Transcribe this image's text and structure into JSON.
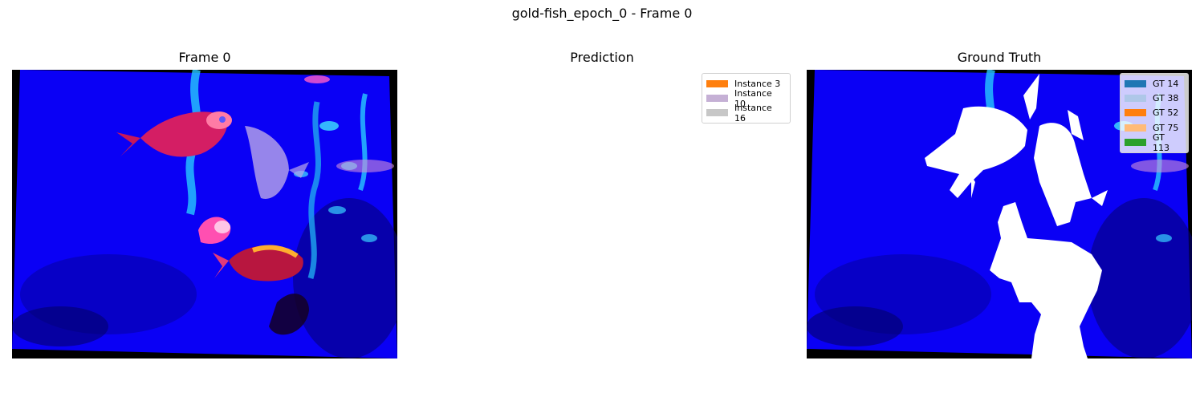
{
  "suptitle": "gold-fish_epoch_0 - Frame 0",
  "panels": {
    "frame": {
      "title": "Frame 0"
    },
    "prediction": {
      "title": "Prediction",
      "legend": [
        {
          "label": "Instance 3",
          "color": "#ff7f0e"
        },
        {
          "label": "Instance 10",
          "color": "#c5b0d5"
        },
        {
          "label": "Instance 16",
          "color": "#c7c7c7"
        }
      ]
    },
    "ground_truth": {
      "title": "Ground Truth",
      "legend": [
        {
          "label": "GT 14",
          "color": "#1f77b4"
        },
        {
          "label": "GT 38",
          "color": "#aec7e8"
        },
        {
          "label": "GT 52",
          "color": "#ff7f0e"
        },
        {
          "label": "GT 75",
          "color": "#ffbb78"
        },
        {
          "label": "GT 113",
          "color": "#2ca02c"
        }
      ]
    }
  },
  "colors": {
    "water": "#0a00f5",
    "mask": "#ffffff",
    "border": "#000000"
  }
}
